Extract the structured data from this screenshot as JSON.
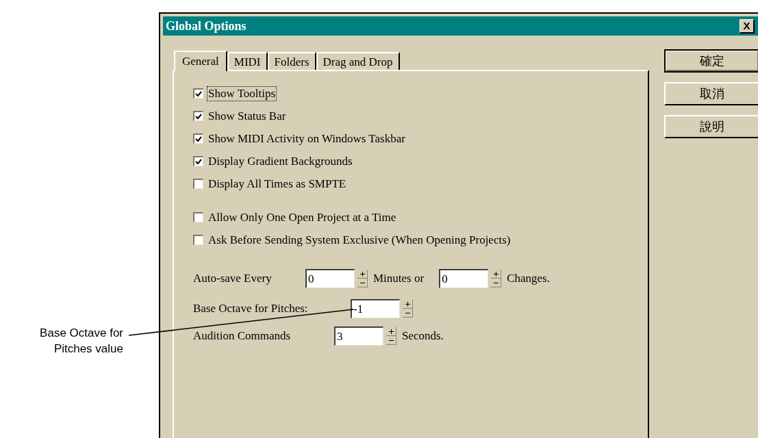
{
  "window": {
    "title": "Global Options",
    "close_label": "X"
  },
  "tabs": [
    {
      "label": "General",
      "selected": true
    },
    {
      "label": "MIDI",
      "selected": false
    },
    {
      "label": "Folders",
      "selected": false
    },
    {
      "label": "Drag and Drop",
      "selected": false
    }
  ],
  "checkbox_groups": [
    [
      {
        "label": "Show Tooltips",
        "checked": true,
        "focused": true
      },
      {
        "label": "Show Status Bar",
        "checked": true,
        "focused": false
      },
      {
        "label": "Show MIDI Activity on Windows Taskbar",
        "checked": true,
        "focused": false
      },
      {
        "label": "Display Gradient Backgrounds",
        "checked": true,
        "focused": false
      },
      {
        "label": "Display All Times as SMPTE",
        "checked": false,
        "focused": false
      }
    ],
    [
      {
        "label": "Allow Only One Open Project at a Time",
        "checked": false,
        "focused": false
      },
      {
        "label": "Ask Before Sending System Exclusive (When Opening Projects)",
        "checked": false,
        "focused": false
      }
    ]
  ],
  "spin_rows": [
    {
      "label": "Auto-save Every",
      "inputs": [
        {
          "value": "0",
          "suffix": "Minutes or"
        },
        {
          "value": "0",
          "suffix": "Changes."
        }
      ]
    },
    {
      "label": "Base Octave for Pitches:",
      "inputs": [
        {
          "value": "-1"
        }
      ]
    },
    {
      "label": "Audition Commands",
      "inputs": [
        {
          "value": "3",
          "suffix": "Seconds."
        }
      ]
    }
  ],
  "buttons": [
    {
      "label": "確定",
      "default": true
    },
    {
      "label": "取消",
      "default": false
    },
    {
      "label": "說明",
      "default": false
    }
  ],
  "callout": {
    "text": "Base Octave for Pitches value"
  }
}
